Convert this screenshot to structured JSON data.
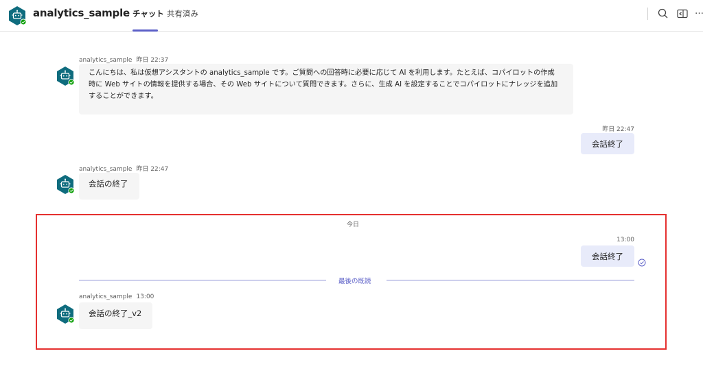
{
  "header": {
    "title": "analytics_sample",
    "tabs": [
      {
        "label": "チャット",
        "active": true
      },
      {
        "label": "共有済み",
        "active": false
      }
    ],
    "more_label": "…"
  },
  "messages": {
    "m1": {
      "sender": "analytics_sample",
      "time": "昨日 22:37",
      "lines": [
        "こんにちは、私は仮想アシスタントの analytics_sample です。ご質問への回答時に必要に応じて AI を利用します。たとえば、コパイロットの作成",
        "時に Web サイトの情報を提供する場合、その Web サイトについて質問できます。さらに、生成 AI を設定することでコパイロットにナレッジを追加",
        "することができます。"
      ]
    },
    "m2": {
      "time": "昨日 22:47",
      "text": "会話終了"
    },
    "m3": {
      "sender": "analytics_sample",
      "time": "昨日 22:47",
      "text": "会話の終了"
    },
    "day_divider": "今日",
    "m4": {
      "time": "13:00",
      "text": "会話終了"
    },
    "last_read": "最後の既読",
    "m5": {
      "sender": "analytics_sample",
      "time": "13:00",
      "text": "会話の終了_v2"
    }
  },
  "colors": {
    "brand": "#5b5fc7",
    "bot_avatar": "#0f6c7e",
    "status_green": "#13a10e",
    "highlight_border": "#e5302f"
  },
  "icons": [
    "bot-icon",
    "status-available-icon",
    "search-icon",
    "popout-icon",
    "more-icon",
    "read-receipt-icon"
  ]
}
